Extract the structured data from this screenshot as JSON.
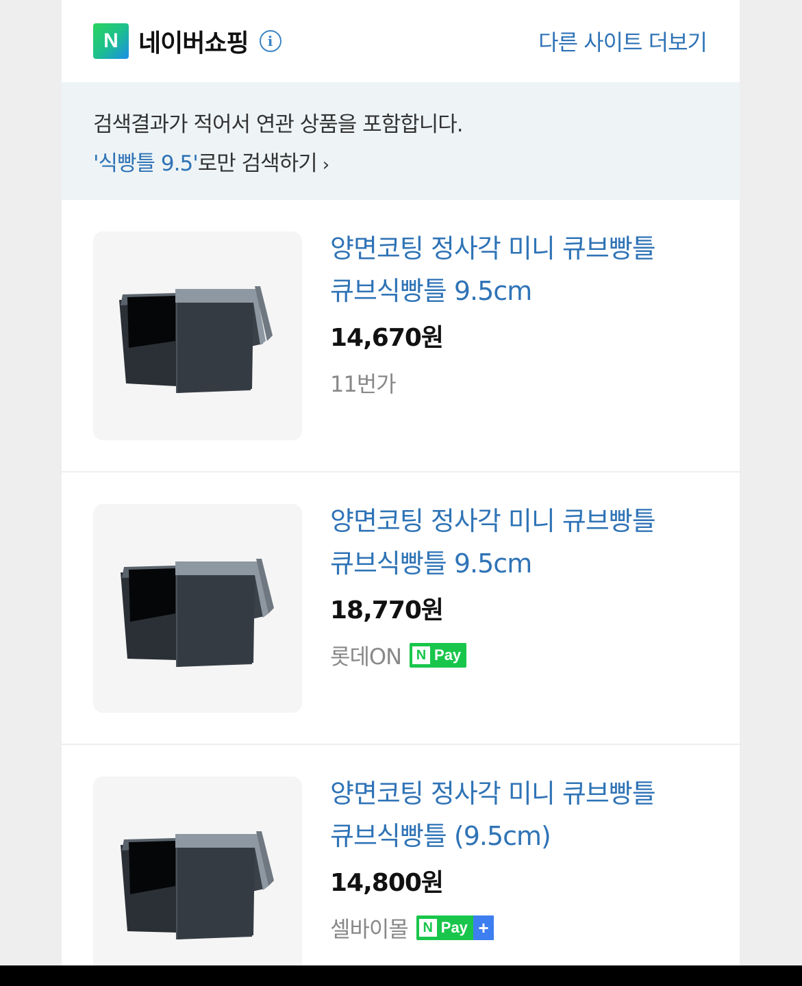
{
  "header": {
    "logo_letter": "N",
    "title": "네이버쇼핑",
    "info_icon": "i",
    "other_sites": "다른 사이트 더보기"
  },
  "notice": {
    "line1": "검색결과가 적어서 연관 상품을 포함합니다.",
    "keyword": "'식빵틀 9.5'",
    "line2_suffix": "로만 검색하기",
    "chevron": "›"
  },
  "products": [
    {
      "title_line1": "양면코팅 정사각 미니 큐브빵틀",
      "title_line2": "큐브식빵틀 9.5cm",
      "price": "14,670원",
      "seller": "11번가",
      "badge": ""
    },
    {
      "title_line1": "양면코팅 정사각 미니 큐브빵틀",
      "title_line2": "큐브식빵틀 9.5cm",
      "price": "18,770원",
      "seller": "롯데ON",
      "badge": {
        "n": "N",
        "pay": "Pay"
      }
    },
    {
      "title_line1": "양면코팅 정사각 미니 큐브빵틀",
      "title_line2": "큐브식빵틀 (9.5cm)",
      "price": "14,800원",
      "seller": "셀바이몰",
      "badge": {
        "n": "N",
        "pay": "Pay",
        "plus": "+"
      }
    }
  ],
  "colors": {
    "link_blue": "#2f73b6",
    "npay_green": "#19c64b",
    "notice_bg": "#eef4f6"
  }
}
